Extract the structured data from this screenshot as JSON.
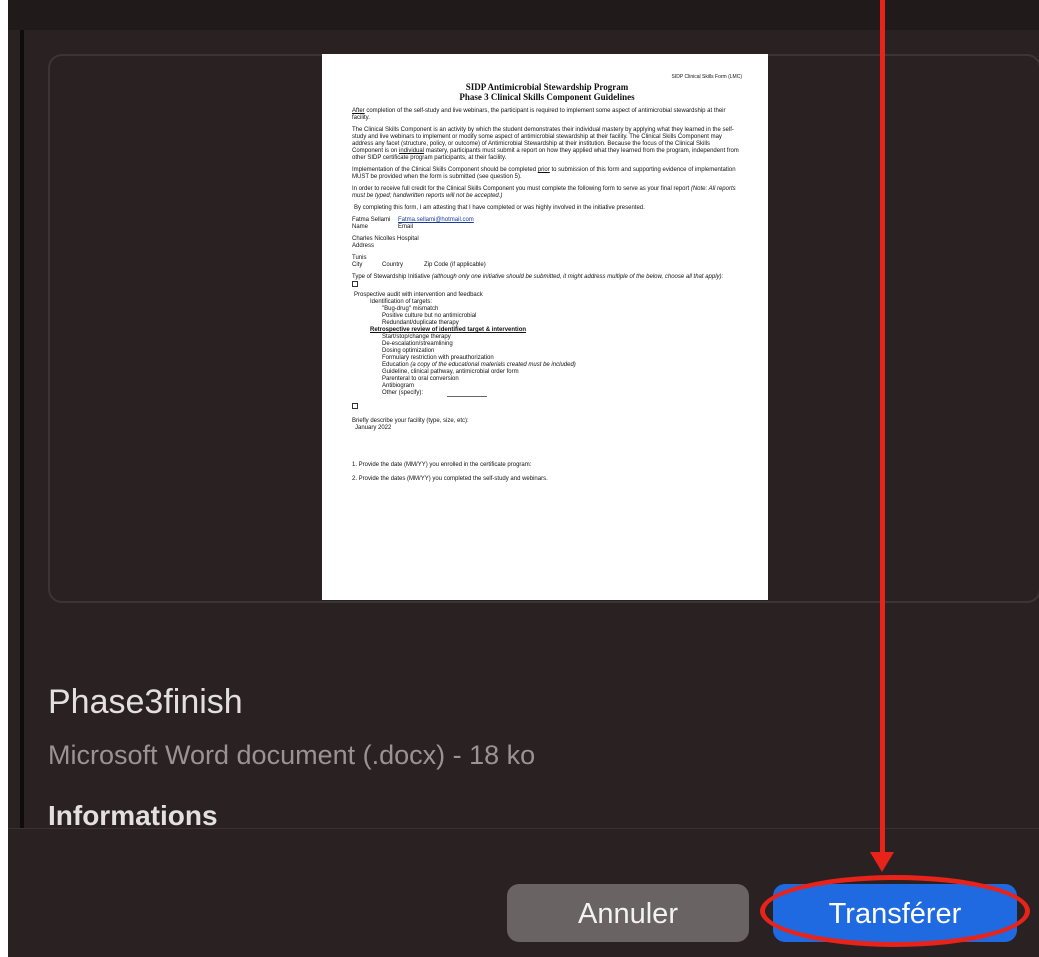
{
  "file": {
    "name": "Phase3finish",
    "meta": "Microsoft Word document (.docx) - 18 ko",
    "info_heading": "Informations"
  },
  "buttons": {
    "cancel": "Annuler",
    "transfer": "Transférer"
  },
  "colors": {
    "background": "#2a2222",
    "primary_button": "#1f6ae0",
    "secondary_button": "#696363",
    "annotation": "#e8231a"
  },
  "document": {
    "header_small": "SIDP Clinical Skills Form (LMC)",
    "title_line1": "SIDP Antimicrobial Stewardship Program",
    "title_line2": "Phase 3 Clinical Skills Component Guidelines",
    "para1_u": "After",
    "para1": " completion of the self-study and live webinars, the participant is required to implement some aspect of antimicrobial stewardship at their facility.",
    "para2a": "The Clinical Skills Component is an activity by which the student demonstrates their individual mastery by applying what they learned in the self-study and live webinars to implement or modify some aspect of antimicrobial stewardship at their facility. The Clinical Skills Component may address any facet (structure, policy, or outcome) of Antimicrobial Stewardship at their institution. Because the focus of the Clinical Skills Component is on ",
    "para2_u": "individual",
    "para2b": " mastery, participants must submit a report on how they applied what they learned from the program, independent from other SIDP certificate program participants, at their facility.",
    "para3a": "Implementation of the Clinical Skills Component should be completed ",
    "para3_u": "prior",
    "para3b": " to submission of this form and supporting evidence of implementation MUST be provided when the form is submitted (see question 5).",
    "para4a": "In order to receive full credit for the Clinical Skills Component you must complete the following form to serve as your final report ",
    "para4_i": "(Note: All reports must be typed; handwritten reports will not be accepted.)",
    "para5": "By completing this form, I am attesting that I have completed or was highly involved in the initiative presented.",
    "person_name": "Fatma Sellami",
    "person_email": "Fatma.sellami@hotmail.com",
    "label_name": "Name",
    "label_email": "Email",
    "address_value": "Charles Nicolles Hospital",
    "label_address": "Address",
    "city_value": "Tunis",
    "label_city": "City",
    "label_country": "Country",
    "label_zip": "Zip Code (if applicable)",
    "type_a": "Type of Stewardship Initiative ",
    "type_i": "(although only one initiative should be submitted, it might address multiple of the below, choose all that apply):",
    "prospective": "Prospective audit with intervention and feedback",
    "identification": "Identification of targets:",
    "bug_drug": "\"Bug-drug\" mismatch",
    "positive_culture": "Positive culture but no antimicrobial",
    "redundant": "Redundant/duplicate therapy",
    "retrospective": "Retrospective review of identified target & intervention",
    "start_stop": "Start/stop/change therapy",
    "deescalation": "De-escalation/streamlining",
    "dosing": "Dosing optimization",
    "formulary": "Formulary restriction with preauthorization",
    "education_a": "Education ",
    "education_i": "(a copy of the educational materials created must be included)",
    "guideline": "Guideline, clinical pathway, antimicrobial order form",
    "parenteral": "Parenteral to oral conversion",
    "antibiogram": "Antibiogram",
    "other": "Other (specify):",
    "briefly": "Briefly describe your facility (type, size, etc):",
    "date_value": "January 2022",
    "q1": "1.  Provide the date (MM/YY) you enrolled in the certificate program:",
    "q2": "2.  Provide the dates (MM/YY) you completed the self-study and webinars."
  }
}
